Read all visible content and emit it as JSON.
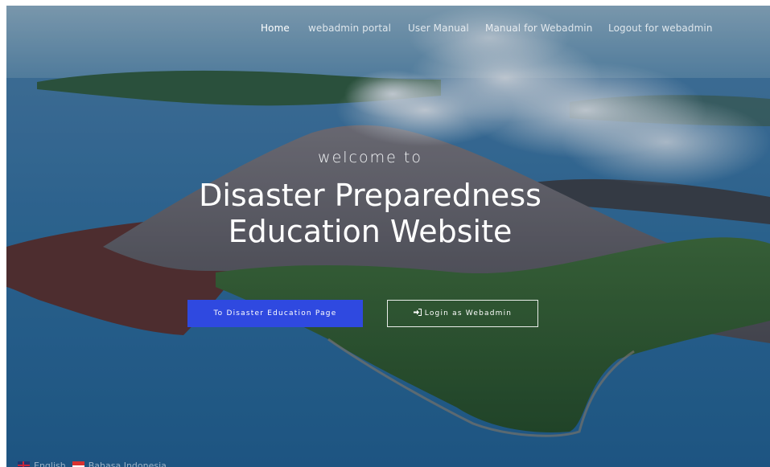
{
  "nav": {
    "items": [
      {
        "label": "Home",
        "active": true
      },
      {
        "label": "webadmin portal",
        "active": false
      },
      {
        "label": "User Manual",
        "active": false
      },
      {
        "label": "Manual for Webadmin",
        "active": false
      },
      {
        "label": "Logout for webadmin",
        "active": false
      }
    ]
  },
  "hero": {
    "welcome": "welcome to",
    "title_line1": "Disaster Preparedness",
    "title_line2": "Education Website",
    "background": "aerial volcano island photo"
  },
  "buttons": {
    "primary_label": "To Disaster Education Page",
    "secondary_label": "Login as Webadmin",
    "secondary_icon": "sign-in-icon"
  },
  "languages": [
    {
      "label": "English",
      "flag": "uk-flag-icon"
    },
    {
      "label": "Bahasa Indonesia",
      "flag": "indonesia-flag-icon"
    }
  ],
  "colors": {
    "primary_button": "#2f49e0",
    "text": "#ffffff"
  }
}
